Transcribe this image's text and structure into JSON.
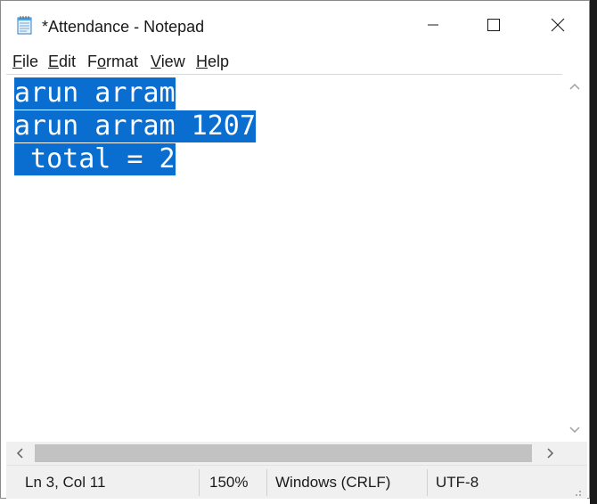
{
  "window": {
    "title": "*Attendance - Notepad",
    "app_icon": "notepad-icon",
    "controls": [
      "minimize-icon",
      "maximize-icon",
      "close-icon"
    ]
  },
  "menu": {
    "file": {
      "accel": "F",
      "rest": "ile"
    },
    "edit": {
      "accel": "E",
      "rest": "dit"
    },
    "format": {
      "pre": "F",
      "accel": "o",
      "rest": "rmat"
    },
    "view": {
      "accel": "V",
      "rest": "iew"
    },
    "help": {
      "accel": "H",
      "rest": "elp"
    }
  },
  "editor": {
    "lines": [
      "arun arram",
      "arun arram 1207",
      " total = 2"
    ],
    "selection_color": "#0a6ed0"
  },
  "status": {
    "position": "Ln 3, Col 11",
    "zoom": "150%",
    "line_ending": "Windows (CRLF)",
    "encoding": "UTF-8"
  }
}
